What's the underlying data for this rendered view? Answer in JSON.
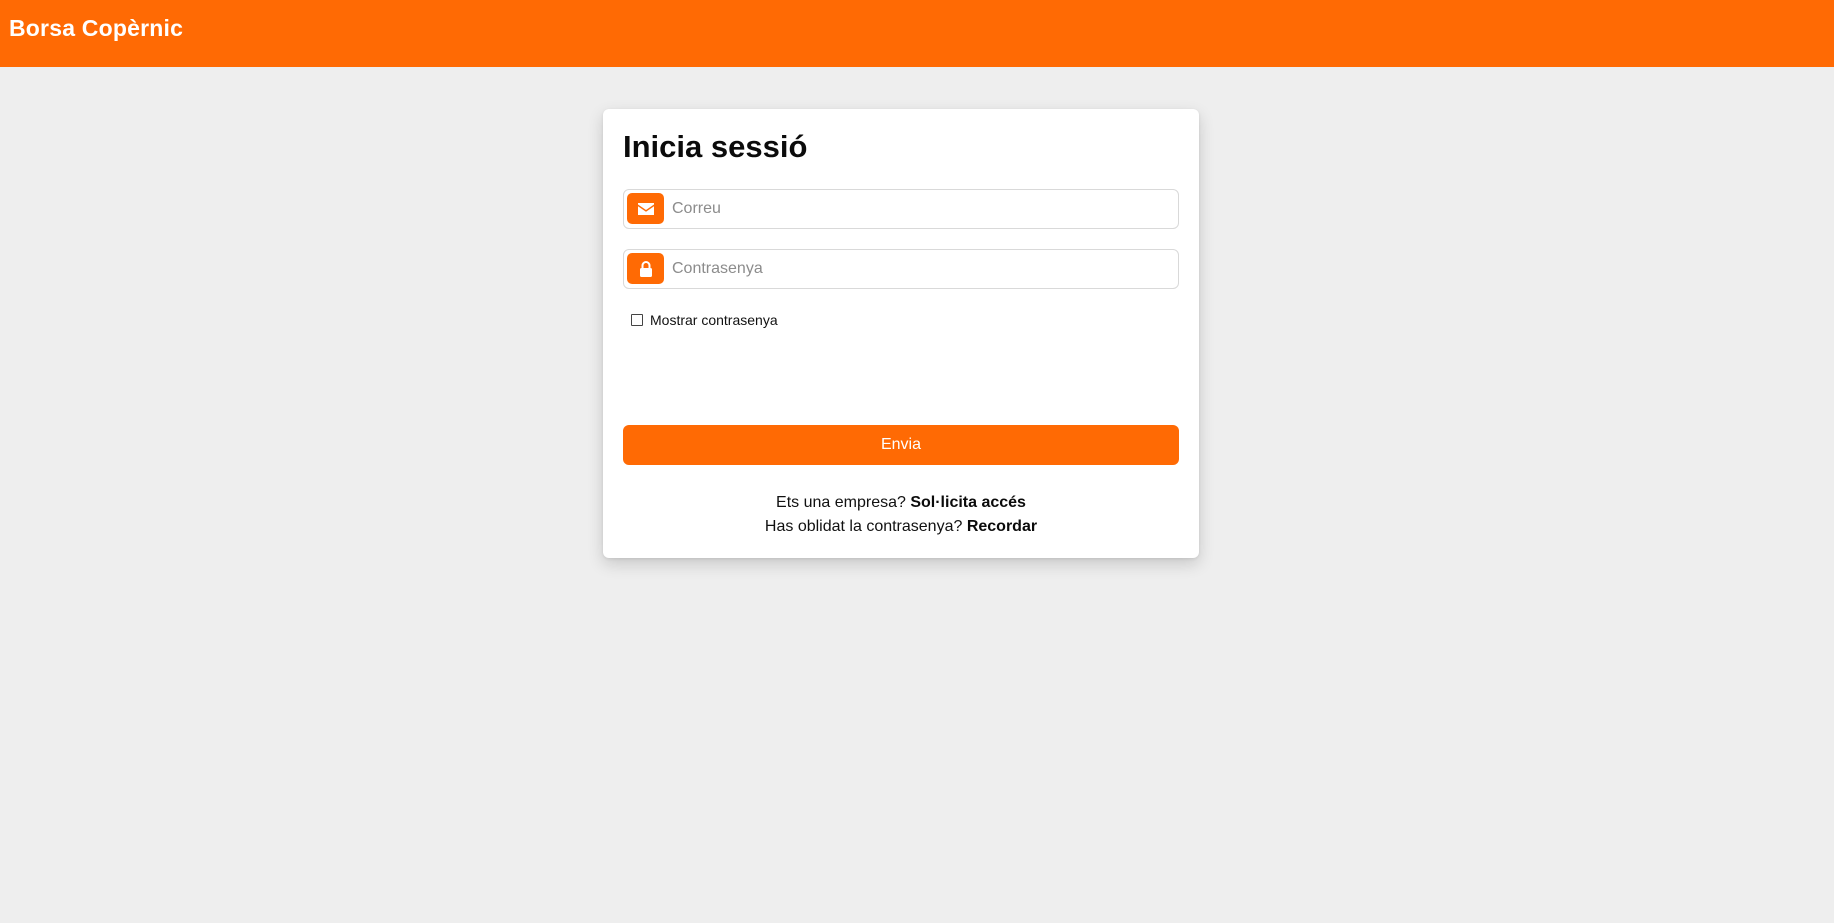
{
  "header": {
    "brand": "Borsa Copèrnic",
    "background_color": "#ff6a04"
  },
  "login": {
    "title": "Inicia sessió",
    "email": {
      "placeholder": "Correu",
      "value": "",
      "icon": "envelope-icon"
    },
    "password": {
      "placeholder": "Contrasenya",
      "value": "",
      "icon": "lock-icon"
    },
    "show_password": {
      "label": "Mostrar contrasenya",
      "checked": false
    },
    "submit_label": "Envia",
    "company_prompt": "Ets una empresa?",
    "company_link": "Sol·licita accés",
    "forgot_prompt": "Has oblidat la contrasenya?",
    "forgot_link": "Recordar"
  },
  "colors": {
    "accent": "#ff6a04",
    "page_background": "#eeeeee",
    "card_background": "#ffffff"
  }
}
